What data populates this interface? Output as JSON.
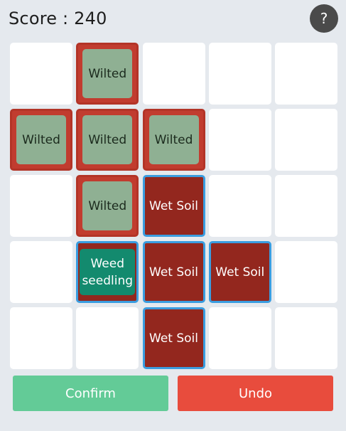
{
  "header": {
    "score_label": "Score : 240",
    "help_label": "?"
  },
  "colors": {
    "background": "#e5e9ee",
    "empty_tile": "#ffffff",
    "wilted_border": "#c13c2f",
    "wilted_plant": "#8fb093",
    "wet_soil": "#93271e",
    "selected_outline": "#3a9de0",
    "weed_seedling": "#138a6e",
    "confirm_button": "#63cb97",
    "undo_button": "#e84c3d"
  },
  "grid": {
    "rows": [
      [
        {
          "type": "empty",
          "label": ""
        },
        {
          "type": "wilted",
          "label": "Wilted"
        },
        {
          "type": "empty",
          "label": ""
        },
        {
          "type": "empty",
          "label": ""
        },
        {
          "type": "empty",
          "label": ""
        }
      ],
      [
        {
          "type": "wilted",
          "label": "Wilted"
        },
        {
          "type": "wilted",
          "label": "Wilted"
        },
        {
          "type": "wilted",
          "label": "Wilted"
        },
        {
          "type": "empty",
          "label": ""
        },
        {
          "type": "empty",
          "label": ""
        }
      ],
      [
        {
          "type": "empty",
          "label": ""
        },
        {
          "type": "wilted",
          "label": "Wilted"
        },
        {
          "type": "wet",
          "label": "Wet Soil"
        },
        {
          "type": "empty",
          "label": ""
        },
        {
          "type": "empty",
          "label": ""
        }
      ],
      [
        {
          "type": "empty",
          "label": ""
        },
        {
          "type": "weed",
          "label": "Weed seedling"
        },
        {
          "type": "wet",
          "label": "Wet Soil"
        },
        {
          "type": "wet",
          "label": "Wet Soil"
        },
        {
          "type": "empty",
          "label": ""
        }
      ],
      [
        {
          "type": "empty",
          "label": ""
        },
        {
          "type": "empty",
          "label": ""
        },
        {
          "type": "wet",
          "label": "Wet Soil"
        },
        {
          "type": "empty",
          "label": ""
        },
        {
          "type": "empty",
          "label": ""
        }
      ]
    ]
  },
  "actions": {
    "confirm_label": "Confirm",
    "undo_label": "Undo"
  }
}
